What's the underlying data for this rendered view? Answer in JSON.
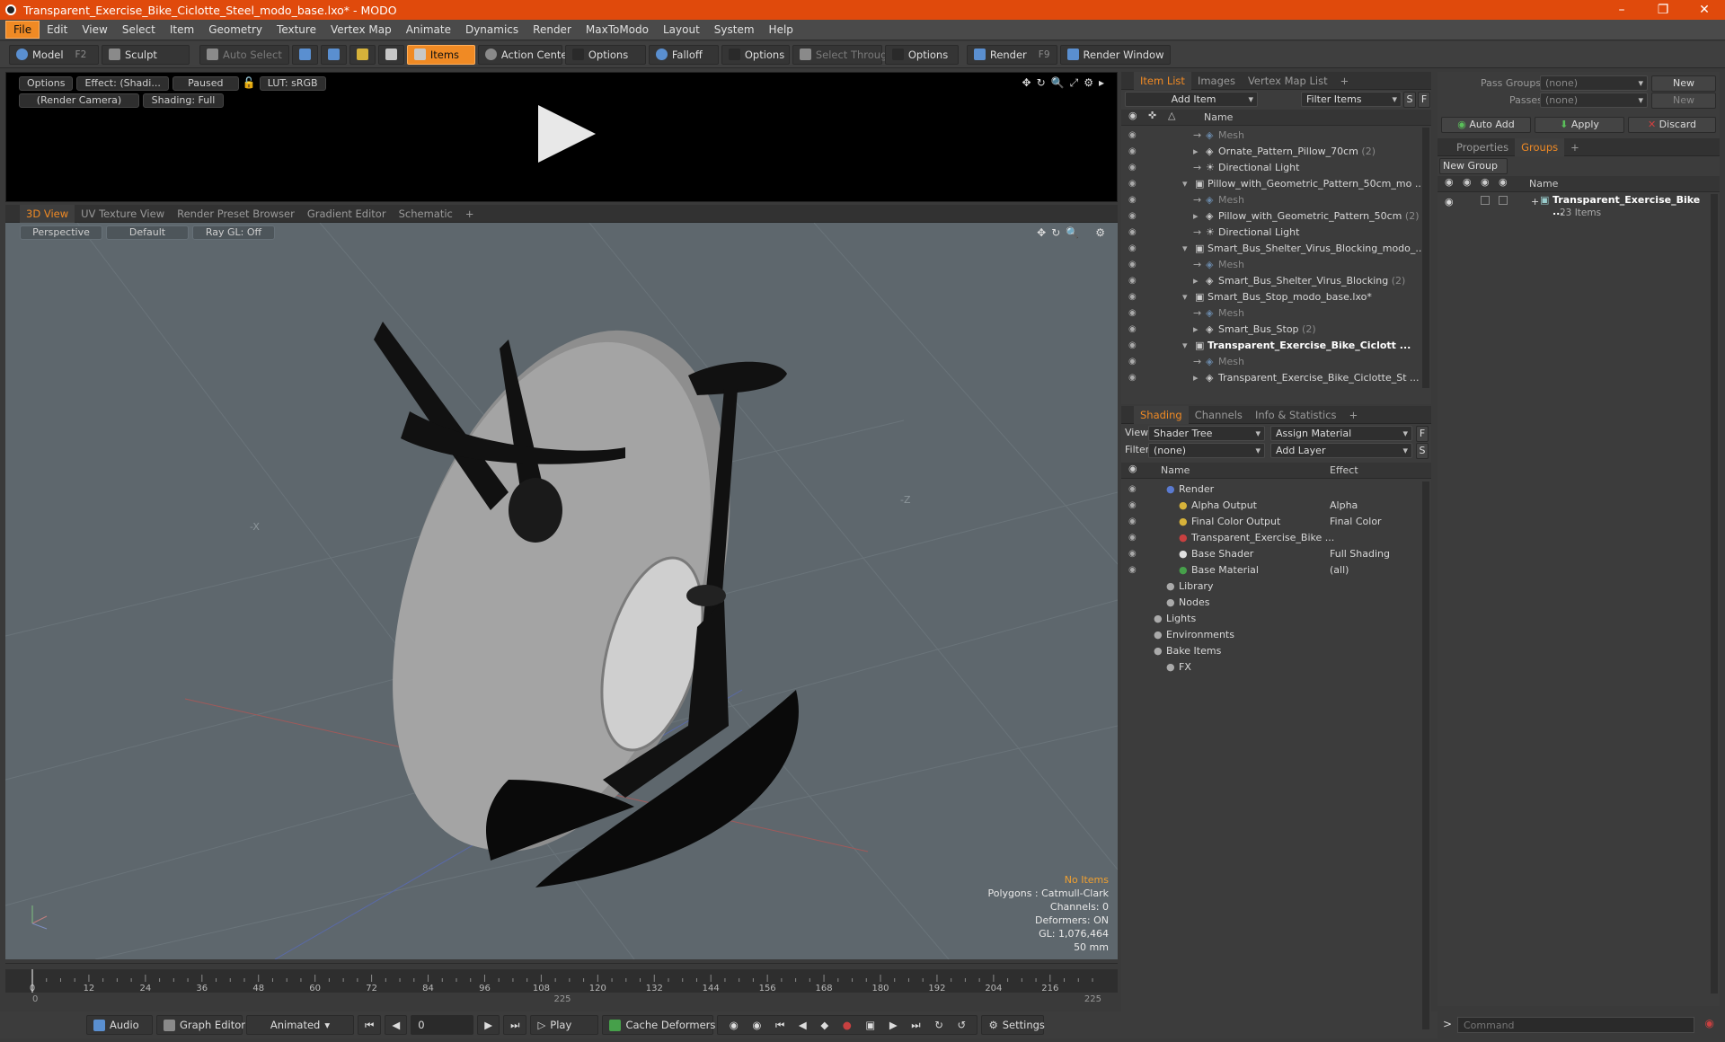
{
  "title": "Transparent_Exercise_Bike_Ciclotte_Steel_modo_base.lxo* - MODO",
  "menu": [
    "File",
    "Edit",
    "View",
    "Select",
    "Item",
    "Geometry",
    "Texture",
    "Vertex Map",
    "Animate",
    "Dynamics",
    "Render",
    "MaxToModo",
    "Layout",
    "System",
    "Help"
  ],
  "toolbar": {
    "model": "Model",
    "model_key": "F2",
    "sculpt": "Sculpt",
    "auto_select": "Auto Select",
    "items": "Items",
    "action_center": "Action Center",
    "options1": "Options",
    "falloff": "Falloff",
    "options2": "Options",
    "select_through": "Select Through",
    "options3": "Options",
    "render": "Render",
    "render_key": "F9",
    "render_window": "Render Window"
  },
  "preview": {
    "options": "Options",
    "effect": "Effect: (Shadi...",
    "paused": "Paused",
    "lut": "LUT: sRGB",
    "camera": "(Render Camera)",
    "shading": "Shading: Full"
  },
  "viewtabs": [
    "3D View",
    "UV Texture View",
    "Render Preset Browser",
    "Gradient Editor",
    "Schematic"
  ],
  "viewport": {
    "perspective": "Perspective",
    "default": "Default",
    "raygl": "Ray GL: Off",
    "info": {
      "no_items": "No Items",
      "polygons": "Polygons : Catmull-Clark",
      "channels": "Channels: 0",
      "deformers": "Deformers: ON",
      "gl": "GL: 1,076,464",
      "mm": "50 mm"
    },
    "axis_x": "-X",
    "axis_z": "-Z"
  },
  "timeline": {
    "ticks": [
      "0",
      "12",
      "24",
      "36",
      "48",
      "60",
      "72",
      "84",
      "96",
      "108",
      "120",
      "132",
      "144",
      "156",
      "168",
      "180",
      "192",
      "204",
      "216"
    ],
    "start": "0",
    "mid": "225",
    "end": "225"
  },
  "bottom": {
    "audio": "Audio",
    "graph_editor": "Graph Editor",
    "animated": "Animated",
    "frame": "0",
    "play": "Play",
    "cache": "Cache Deformers",
    "settings": "Settings"
  },
  "itemlist": {
    "tabs": [
      "Item List",
      "Images",
      "Vertex Map List"
    ],
    "add_item": "Add Item",
    "filter": "Filter Items",
    "s": "S",
    "f": "F",
    "col_name": "Name",
    "rows": [
      {
        "label": "Mesh",
        "indent": 3,
        "style": "grey"
      },
      {
        "label": "Ornate_Pattern_Pillow_70cm",
        "count": "(2)",
        "indent": 3,
        "style": ""
      },
      {
        "label": "Directional Light",
        "indent": 3,
        "style": ""
      },
      {
        "label": "Pillow_with_Geometric_Pattern_50cm_mo ...",
        "indent": 2,
        "style": ""
      },
      {
        "label": "Mesh",
        "indent": 3,
        "style": "grey"
      },
      {
        "label": "Pillow_with_Geometric_Pattern_50cm",
        "count": "(2)",
        "indent": 3,
        "style": ""
      },
      {
        "label": "Directional Light",
        "indent": 3,
        "style": ""
      },
      {
        "label": "Smart_Bus_Shelter_Virus_Blocking_modo_...",
        "indent": 2,
        "style": ""
      },
      {
        "label": "Mesh",
        "indent": 3,
        "style": "grey"
      },
      {
        "label": "Smart_Bus_Shelter_Virus_Blocking",
        "count": "(2)",
        "indent": 3,
        "style": ""
      },
      {
        "label": "Smart_Bus_Stop_modo_base.lxo*",
        "indent": 2,
        "style": ""
      },
      {
        "label": "Mesh",
        "indent": 3,
        "style": "grey"
      },
      {
        "label": "Smart_Bus_Stop",
        "count": "(2)",
        "indent": 3,
        "style": ""
      },
      {
        "label": "Transparent_Exercise_Bike_Ciclott ...",
        "indent": 2,
        "style": "bold"
      },
      {
        "label": "Mesh",
        "indent": 3,
        "style": "grey"
      },
      {
        "label": "Transparent_Exercise_Bike_Ciclotte_St ...",
        "indent": 3,
        "style": ""
      }
    ]
  },
  "shading": {
    "tabs": [
      "Shading",
      "Channels",
      "Info & Statistics"
    ],
    "view_label": "View",
    "view_value": "Shader Tree",
    "assign": "Assign Material",
    "f": "F",
    "filter_label": "Filter",
    "filter_value": "(none)",
    "add_layer": "Add Layer",
    "s": "S",
    "col_name": "Name",
    "col_effect": "Effect",
    "rows": [
      {
        "label": "Render",
        "effect": "",
        "indent": 1
      },
      {
        "label": "Alpha Output",
        "effect": "Alpha",
        "indent": 2
      },
      {
        "label": "Final Color Output",
        "effect": "Final Color",
        "indent": 2
      },
      {
        "label": "Transparent_Exercise_Bike ...",
        "effect": "",
        "indent": 2
      },
      {
        "label": "Base Shader",
        "effect": "Full Shading",
        "indent": 2
      },
      {
        "label": "Base Material",
        "effect": "(all)",
        "indent": 2
      },
      {
        "label": "Library",
        "effect": "",
        "indent": 1
      },
      {
        "label": "Nodes",
        "effect": "",
        "indent": 1
      },
      {
        "label": "Lights",
        "effect": "",
        "indent": 0
      },
      {
        "label": "Environments",
        "effect": "",
        "indent": 0
      },
      {
        "label": "Bake Items",
        "effect": "",
        "indent": 0
      },
      {
        "label": "FX",
        "effect": "",
        "indent": 1
      }
    ]
  },
  "groups": {
    "pass_groups": "Pass Groups",
    "pass_value": "(none)",
    "new": "New",
    "passes": "Passes",
    "passes_value": "(none)",
    "new2": "New",
    "auto_add": "Auto Add",
    "apply": "Apply",
    "discard": "Discard",
    "tabs": [
      "Properties",
      "Groups"
    ],
    "new_group": "New Group",
    "col_name": "Name",
    "item": "Transparent_Exercise_Bike ...",
    "item_count": "23 Items"
  },
  "command": {
    "placeholder": "Command"
  }
}
